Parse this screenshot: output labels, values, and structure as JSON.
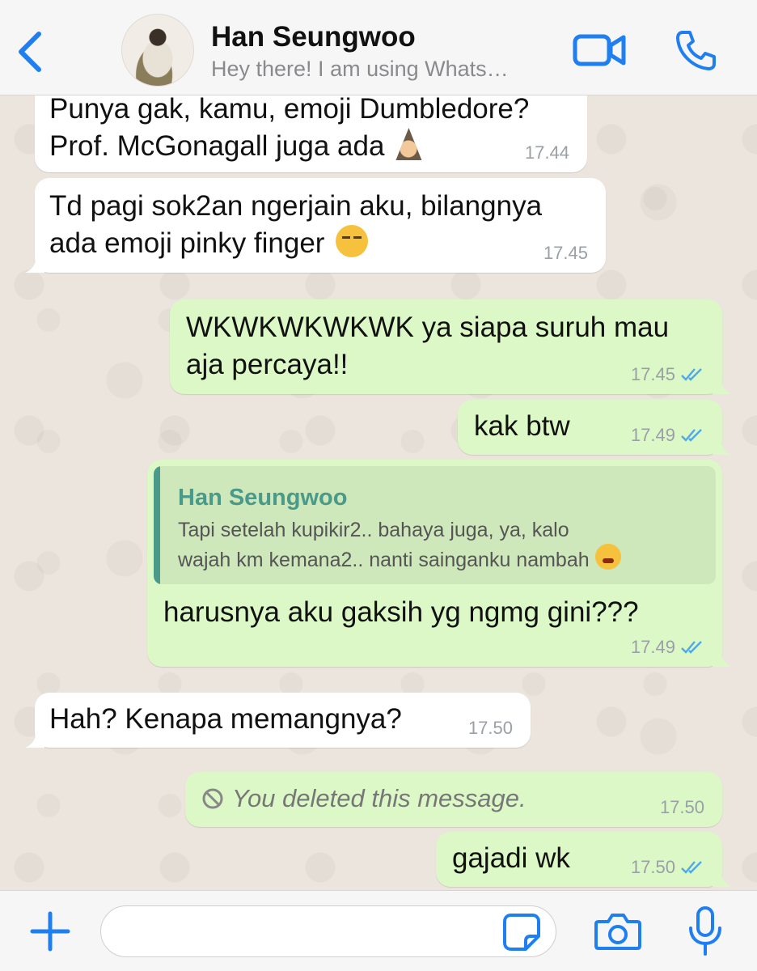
{
  "header": {
    "contact_name": "Han Seungwoo",
    "contact_status": "Hey there! I am using Whats…"
  },
  "colors": {
    "accent": "#1f7ff0",
    "incoming_bubble": "#ffffff",
    "outgoing_bubble": "#dcf8c6",
    "read_ticks": "#4fa8e8",
    "quote_accent": "#4a9a8a"
  },
  "messages": [
    {
      "direction": "in",
      "text": "Punya gak, kamu, emoji Dumbledore?\nProf. McGonagall juga ada",
      "emoji": "wizard-emoji",
      "time": "17.44"
    },
    {
      "direction": "in",
      "text": "Td pagi sok2an ngerjain aku, bilangnya\nada emoji pinky finger",
      "emoji": "unamused-emoji",
      "time": "17.45"
    },
    {
      "direction": "out",
      "text": "WKWKWKWKWK ya siapa suruh mau\naja percaya!!",
      "time": "17.45",
      "read": true
    },
    {
      "direction": "out",
      "text": "kak btw",
      "time": "17.49",
      "read": true
    },
    {
      "direction": "out",
      "text": "harusnya aku gaksih yg ngmg gini???",
      "time": "17.49",
      "read": true,
      "quote": {
        "name": "Han Seungwoo",
        "text": "Tapi setelah kupikir2.. bahaya juga, ya, kalo\nwajah km kemana2.. nanti sainganku nambah",
        "emoji": "steam-emoji"
      }
    },
    {
      "direction": "in",
      "text": "Hah? Kenapa memangnya?",
      "time": "17.50"
    },
    {
      "direction": "out",
      "text": "You deleted this message.",
      "time": "17.50",
      "deleted": true
    },
    {
      "direction": "out",
      "text": "gajadi wk",
      "time": "17.50",
      "read": true
    }
  ],
  "composer": {
    "value": "",
    "placeholder": ""
  },
  "icons": {
    "back": "chevron-left-icon",
    "video": "video-camera-icon",
    "call": "phone-icon",
    "plus": "plus-icon",
    "sticker": "sticker-icon",
    "camera": "camera-icon",
    "mic": "microphone-icon",
    "ticks": "double-check-icon",
    "deleted": "prohibited-icon"
  }
}
